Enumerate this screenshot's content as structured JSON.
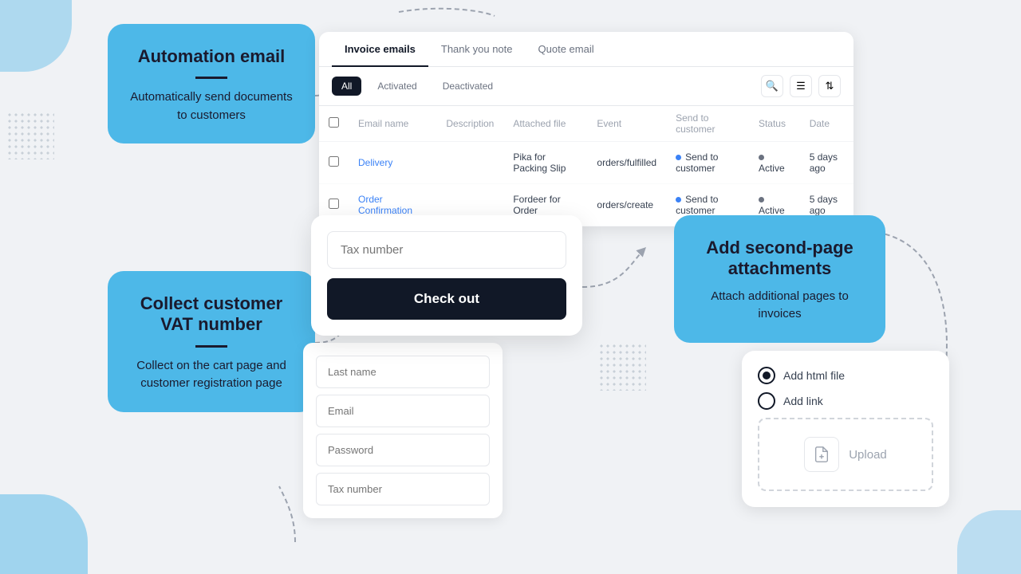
{
  "page": {
    "background": "#f0f2f5"
  },
  "automation": {
    "title": "Automation email",
    "description": "Automatically send documents to customers",
    "tabs": [
      "Invoice emails",
      "Thank you note",
      "Quote email"
    ],
    "active_tab": "Invoice emails",
    "filters": [
      "All",
      "Activated",
      "Deactivated"
    ],
    "active_filter": "All",
    "table": {
      "headers": [
        "Email name",
        "Description",
        "Attached file",
        "Event",
        "Send to customer",
        "Status",
        "Date"
      ],
      "rows": [
        {
          "name": "Delivery",
          "description": "",
          "attached_file": "Pika for Packing Slip",
          "event": "orders/fulfilled",
          "send_to_customer": "Send to customer",
          "status": "Active",
          "date": "5 days ago"
        },
        {
          "name": "Order Confirmation",
          "description": "",
          "attached_file": "Fordeer for Order",
          "event": "orders/create",
          "send_to_customer": "Send to customer",
          "status": "Active",
          "date": "5 days ago"
        }
      ]
    }
  },
  "vat": {
    "title": "Collect customer VAT number",
    "description": "Collect on the cart page and customer registration page"
  },
  "checkout": {
    "tax_placeholder": "Tax number",
    "button_label": "Check out"
  },
  "registration": {
    "fields": [
      "Last name",
      "Email",
      "Password",
      "Tax number"
    ]
  },
  "attachments": {
    "title": "Add second-page attachments",
    "description": "Attach additional pages to invoices",
    "options": [
      "Add html file",
      "Add link"
    ],
    "upload_label": "Upload"
  }
}
